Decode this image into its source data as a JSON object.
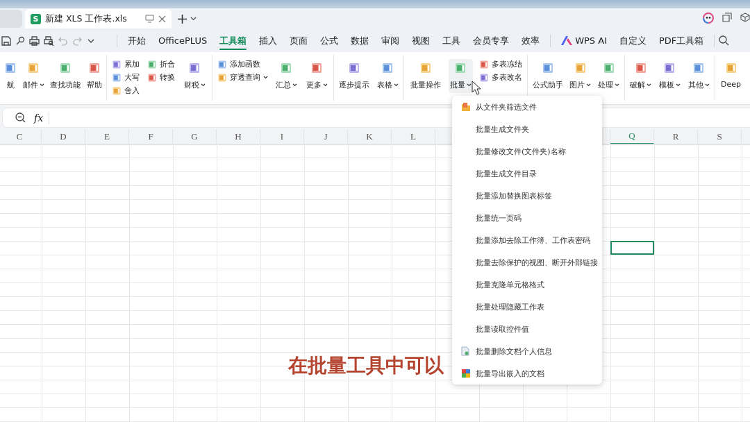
{
  "document_tab": {
    "title": "新建 XLS 工作表.xls",
    "app_letter": "S"
  },
  "menu_tabs": [
    {
      "label": "开始",
      "selected": false,
      "kind": "text"
    },
    {
      "label": "OfficePLUS",
      "selected": false,
      "kind": "text"
    },
    {
      "label": "工具箱",
      "selected": true,
      "kind": "text"
    },
    {
      "label": "插入",
      "selected": false,
      "kind": "text"
    },
    {
      "label": "页面",
      "selected": false,
      "kind": "text"
    },
    {
      "label": "公式",
      "selected": false,
      "kind": "text"
    },
    {
      "label": "数据",
      "selected": false,
      "kind": "text"
    },
    {
      "label": "审阅",
      "selected": false,
      "kind": "text"
    },
    {
      "label": "视图",
      "selected": false,
      "kind": "text"
    },
    {
      "label": "工具",
      "selected": false,
      "kind": "text"
    },
    {
      "label": "会员专享",
      "selected": false,
      "kind": "text"
    },
    {
      "label": "效率",
      "selected": false,
      "kind": "text"
    },
    {
      "label": "WPS AI",
      "selected": false,
      "kind": "ai"
    },
    {
      "label": "自定义",
      "selected": false,
      "kind": "text"
    },
    {
      "label": "PDF工具箱",
      "selected": false,
      "kind": "text"
    }
  ],
  "ribbon_groups": [
    {
      "items": [
        {
          "kind": "large",
          "label": "航",
          "dropdown": false
        },
        {
          "kind": "large",
          "label": "邮件",
          "dropdown": true
        },
        {
          "kind": "large",
          "label": "查找功能",
          "dropdown": false
        },
        {
          "kind": "large",
          "label": "帮助",
          "dropdown": false
        }
      ]
    },
    {
      "items": [
        {
          "kind": "stack",
          "children": [
            {
              "label": "累加"
            },
            {
              "label": "大写"
            },
            {
              "label": "舍入"
            }
          ]
        },
        {
          "kind": "stack",
          "children": [
            {
              "label": "折合"
            },
            {
              "label": "转换"
            }
          ]
        },
        {
          "kind": "large",
          "label": "财税",
          "dropdown": true
        }
      ]
    },
    {
      "items": [
        {
          "kind": "stack",
          "children": [
            {
              "label": "添加函数",
              "dropdown": false
            },
            {
              "label": "穿透查询",
              "dropdown": true
            }
          ]
        },
        {
          "kind": "large",
          "label": "汇总",
          "dropdown": true
        },
        {
          "kind": "large",
          "label": "更多",
          "dropdown": true
        }
      ]
    },
    {
      "items": [
        {
          "kind": "large",
          "label": "逐步提示",
          "dropdown": false
        },
        {
          "kind": "large",
          "label": "表格",
          "dropdown": true
        }
      ]
    },
    {
      "items": [
        {
          "kind": "large",
          "label": "批量操作",
          "dropdown": false
        },
        {
          "kind": "large",
          "label": "批量",
          "dropdown": true,
          "pressed": true
        },
        {
          "kind": "stack",
          "children": [
            {
              "label": "多表冻结"
            },
            {
              "label": "多表改名"
            }
          ]
        }
      ]
    },
    {
      "items": [
        {
          "kind": "large",
          "label": "公式助手",
          "dropdown": false
        },
        {
          "kind": "large",
          "label": "图片",
          "dropdown": true
        },
        {
          "kind": "large",
          "label": "处理",
          "dropdown": true
        }
      ]
    },
    {
      "items": [
        {
          "kind": "large",
          "label": "破解",
          "dropdown": true
        },
        {
          "kind": "large",
          "label": "模板",
          "dropdown": true
        },
        {
          "kind": "large",
          "label": "其他",
          "dropdown": true
        }
      ]
    },
    {
      "items": [
        {
          "kind": "large",
          "label": "Deep",
          "dropdown": false
        }
      ]
    }
  ],
  "formula_bar": {
    "fx_label": "fx"
  },
  "columns_left": [
    {
      "label": "C",
      "selected": false
    },
    {
      "label": "D",
      "selected": false
    },
    {
      "label": "E",
      "selected": false
    },
    {
      "label": "F",
      "selected": false
    },
    {
      "label": "G",
      "selected": false
    },
    {
      "label": "H",
      "selected": false
    },
    {
      "label": "I",
      "selected": false
    },
    {
      "label": "J",
      "selected": false
    },
    {
      "label": "K",
      "selected": false
    },
    {
      "label": "L",
      "selected": false
    }
  ],
  "columns_right": [
    {
      "label": "Q",
      "selected": true
    },
    {
      "label": "R",
      "selected": false
    },
    {
      "label": "S",
      "selected": false
    }
  ],
  "dropdown_menu": [
    {
      "label": "从文件夹筛选文件",
      "kind": "folder"
    },
    {
      "label": "批量生成文件夹",
      "kind": "plain"
    },
    {
      "label": "批量修改文件(文件夹)名称",
      "kind": "plain"
    },
    {
      "label": "批量生成文件目录",
      "kind": "plain"
    },
    {
      "label": "批量添加替换图表标签",
      "kind": "plain"
    },
    {
      "label": "批量统一页码",
      "kind": "plain"
    },
    {
      "label": "批量添加去除工作簿、工作表密码",
      "kind": "plain"
    },
    {
      "label": "批量去除保护的视图、断开外部链接",
      "kind": "plain"
    },
    {
      "label": "批量克隆单元格格式",
      "kind": "plain"
    },
    {
      "label": "批量处理隐藏工作表",
      "kind": "plain"
    },
    {
      "label": "批量读取控件值",
      "kind": "plain"
    },
    {
      "label": "批量删除文档个人信息",
      "kind": "document"
    },
    {
      "label": "批量导出嵌入的文档",
      "kind": "export"
    }
  ],
  "caption": "在批量工具中可以"
}
